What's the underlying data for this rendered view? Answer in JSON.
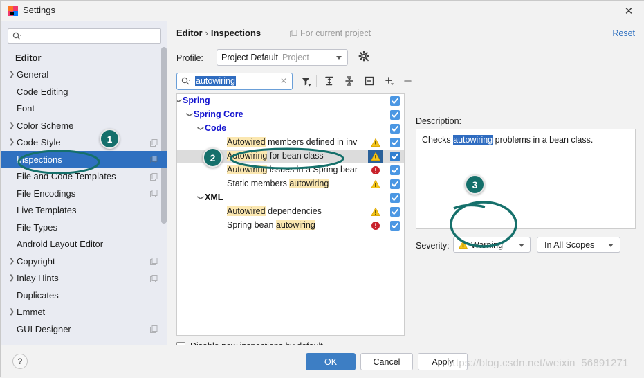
{
  "window": {
    "title": "Settings",
    "close_label": "✕",
    "app_icon": "intellij-logo-icon"
  },
  "sidebar": {
    "search_placeholder": "",
    "search_value": "",
    "section_title": "Editor",
    "items": [
      {
        "label": "General",
        "expandable": true,
        "copy": false,
        "selected": false
      },
      {
        "label": "Code Editing",
        "expandable": false,
        "copy": false,
        "selected": false
      },
      {
        "label": "Font",
        "expandable": false,
        "copy": false,
        "selected": false
      },
      {
        "label": "Color Scheme",
        "expandable": true,
        "copy": false,
        "selected": false
      },
      {
        "label": "Code Style",
        "expandable": true,
        "copy": true,
        "selected": false
      },
      {
        "label": "Inspections",
        "expandable": false,
        "copy": true,
        "selected": true
      },
      {
        "label": "File and Code Templates",
        "expandable": false,
        "copy": true,
        "selected": false
      },
      {
        "label": "File Encodings",
        "expandable": false,
        "copy": true,
        "selected": false
      },
      {
        "label": "Live Templates",
        "expandable": false,
        "copy": false,
        "selected": false
      },
      {
        "label": "File Types",
        "expandable": false,
        "copy": false,
        "selected": false
      },
      {
        "label": "Android Layout Editor",
        "expandable": false,
        "copy": false,
        "selected": false
      },
      {
        "label": "Copyright",
        "expandable": true,
        "copy": true,
        "selected": false
      },
      {
        "label": "Inlay Hints",
        "expandable": true,
        "copy": true,
        "selected": false
      },
      {
        "label": "Duplicates",
        "expandable": false,
        "copy": false,
        "selected": false
      },
      {
        "label": "Emmet",
        "expandable": true,
        "copy": false,
        "selected": false
      },
      {
        "label": "GUI Designer",
        "expandable": false,
        "copy": true,
        "selected": false
      }
    ]
  },
  "header": {
    "breadcrumb_root": "Editor",
    "breadcrumb_sep": "›",
    "breadcrumb_current": "Inspections",
    "for_current_project": "For current project",
    "reset_label": "Reset"
  },
  "profile": {
    "label": "Profile:",
    "value": "Project Default",
    "modifier": "Project",
    "gear_icon": "gear-icon"
  },
  "filter_bar": {
    "search_value": "autowiring",
    "clear_label": "✕",
    "icons": [
      "filter-icon",
      "expand-all-icon",
      "collapse-all-icon",
      "group-by-icon",
      "add-icon",
      "remove-icon"
    ]
  },
  "inspections": {
    "rows": [
      {
        "label": "Spring",
        "indent": 8,
        "chevron": "⌄",
        "style": "blue",
        "severity": "",
        "checked": true,
        "selected": false,
        "highlight": ""
      },
      {
        "label": "Spring Core",
        "indent": 24,
        "chevron": "⌄",
        "style": "blue",
        "severity": "",
        "checked": true,
        "selected": false,
        "highlight": ""
      },
      {
        "label": "Code",
        "indent": 40,
        "chevron": "⌄",
        "style": "blue",
        "severity": "",
        "checked": true,
        "selected": false,
        "highlight": ""
      },
      {
        "label": "Autowired members defined in inv",
        "indent": 72,
        "chevron": "",
        "style": "plain",
        "severity": "warning",
        "checked": true,
        "selected": false,
        "highlight": "Autowired"
      },
      {
        "label": "Autowiring for bean class",
        "indent": 72,
        "chevron": "",
        "style": "plain",
        "severity": "warning",
        "checked": true,
        "selected": true,
        "highlight": "Autowiring"
      },
      {
        "label": "Autowiring issues in a Spring bear",
        "indent": 72,
        "chevron": "",
        "style": "plain",
        "severity": "error",
        "checked": true,
        "selected": false,
        "highlight": "Autowiring"
      },
      {
        "label": "Static members autowiring",
        "indent": 72,
        "chevron": "",
        "style": "plain",
        "severity": "warning",
        "checked": true,
        "selected": false,
        "highlight": "autowiring"
      },
      {
        "label": "XML",
        "indent": 40,
        "chevron": "⌄",
        "style": "dark",
        "severity": "",
        "checked": true,
        "selected": false,
        "highlight": ""
      },
      {
        "label": "Autowired dependencies",
        "indent": 72,
        "chevron": "",
        "style": "plain",
        "severity": "warning",
        "checked": true,
        "selected": false,
        "highlight": "Autowired"
      },
      {
        "label": "Spring bean autowiring",
        "indent": 72,
        "chevron": "",
        "style": "plain",
        "severity": "error",
        "checked": true,
        "selected": false,
        "highlight": "autowiring"
      }
    ],
    "disable_new_label": "Disable new inspections by default",
    "disable_new_checked": false
  },
  "description": {
    "label": "Description:",
    "text_before": "Checks ",
    "text_selected": "autowiring",
    "text_after": " problems in a bean class."
  },
  "severity": {
    "label": "Severity:",
    "value": "Warning",
    "icon": "warning-triangle-icon",
    "scope_value": "In All Scopes"
  },
  "footer": {
    "help_label": "?",
    "ok_label": "OK",
    "cancel_label": "Cancel",
    "apply_label": "Apply"
  },
  "annotations": {
    "badge1": "1",
    "badge2": "2",
    "badge3": "3",
    "accent_color": "#15706b"
  },
  "watermark": {
    "text": "https://blog.csdn.net/weixin_56891271"
  }
}
